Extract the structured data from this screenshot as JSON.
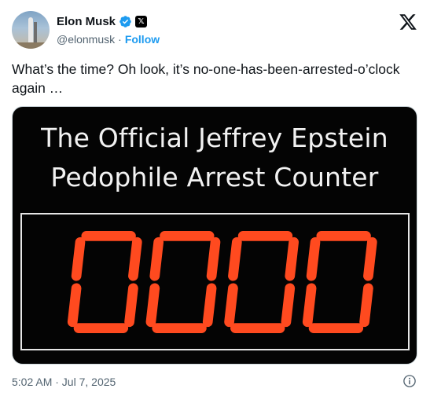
{
  "author": {
    "name": "Elon Musk",
    "handle": "@elonmusk",
    "separator": "·",
    "follow_label": "Follow",
    "badge_icon": "verified-icon",
    "affiliate_badge": "𝕏"
  },
  "tweet": {
    "text": "What’s the time? Oh look, it’s no-one-has-been-arrested-o’clock again …",
    "timestamp": "5:02 AM · Jul 7, 2025"
  },
  "media": {
    "title_line1": "The Official Jeffrey Epstein",
    "title_line2": "Pedophile Arrest Counter",
    "counter_value": "0000",
    "digit_color": "#ff4a1f"
  },
  "colors": {
    "accent": "#1d9bf0",
    "secondary_text": "#536471",
    "primary_text": "#0f1419"
  }
}
